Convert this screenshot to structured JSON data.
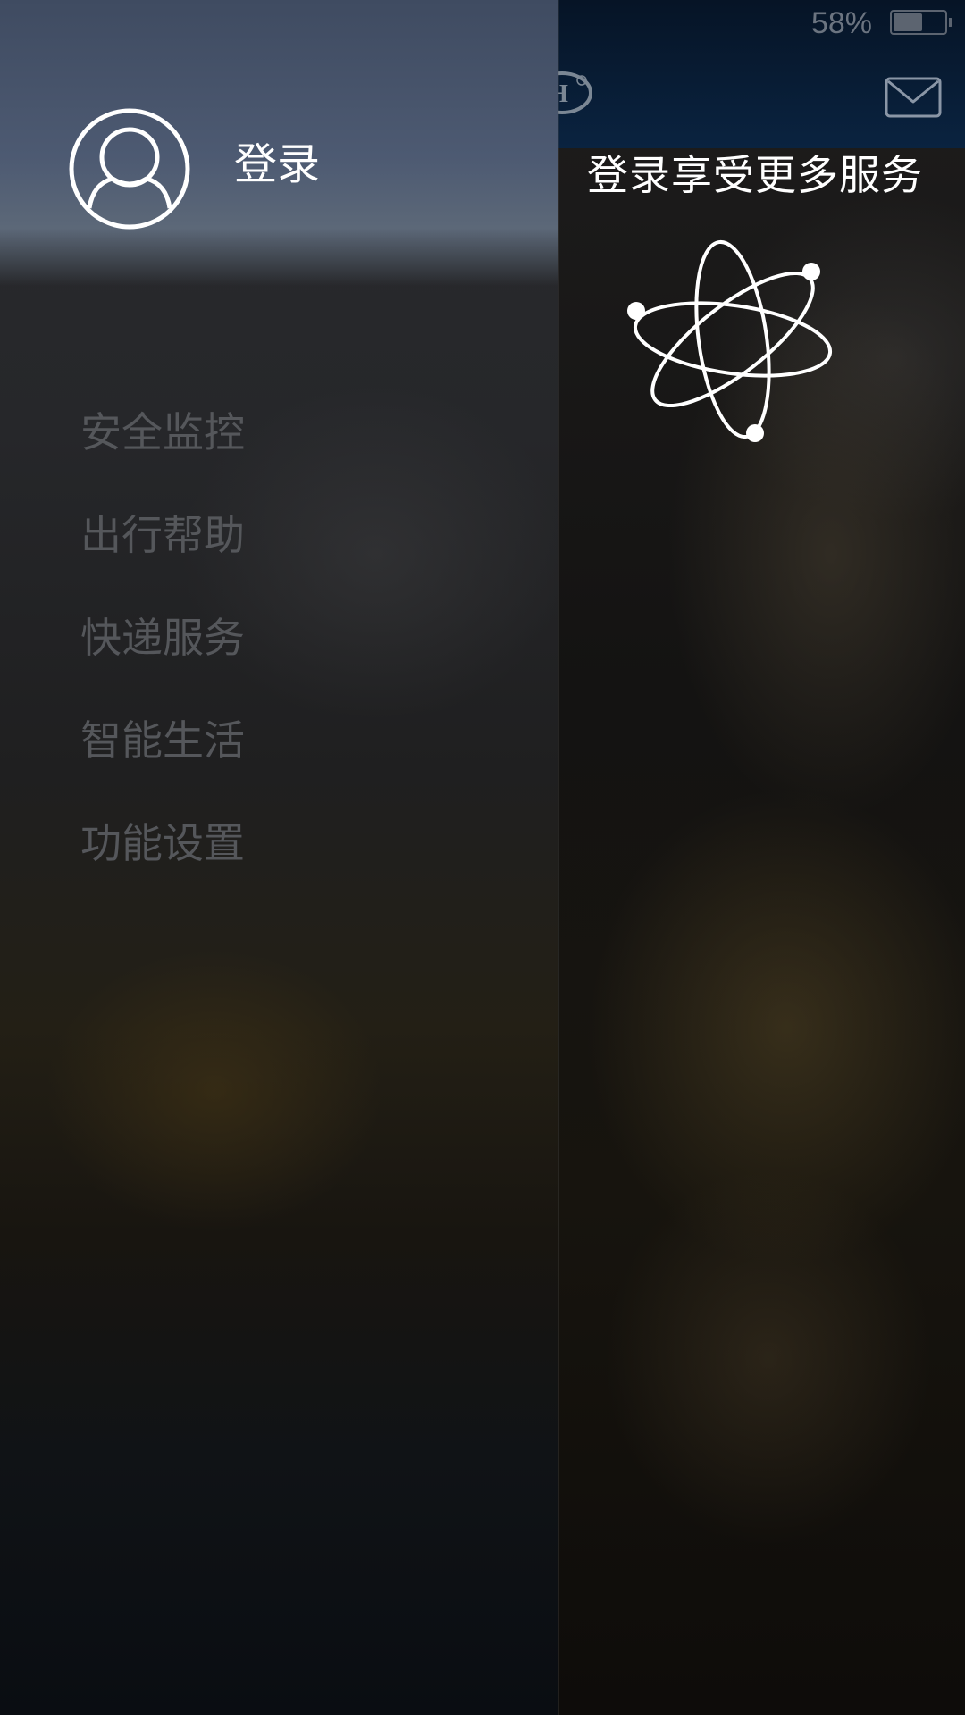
{
  "status_bar": {
    "battery_percent_text": "58%",
    "battery_level": 0.58
  },
  "main": {
    "promo_text": "登录享受更多服务",
    "icons": {
      "brand": "brand-logo",
      "mail": "mail-icon",
      "atom": "atom-icon"
    },
    "colors": {
      "topbar": "#0a2340",
      "promo_text": "#ffffff"
    }
  },
  "drawer": {
    "login_label": "登录",
    "avatar_icon": "user-avatar-icon",
    "menu_items": [
      {
        "label": "安全监控"
      },
      {
        "label": "出行帮助"
      },
      {
        "label": "快递服务"
      },
      {
        "label": "智能生活"
      },
      {
        "label": "功能设置"
      }
    ],
    "colors": {
      "header": "#4d5a72",
      "menu_text": "#55575b"
    }
  }
}
